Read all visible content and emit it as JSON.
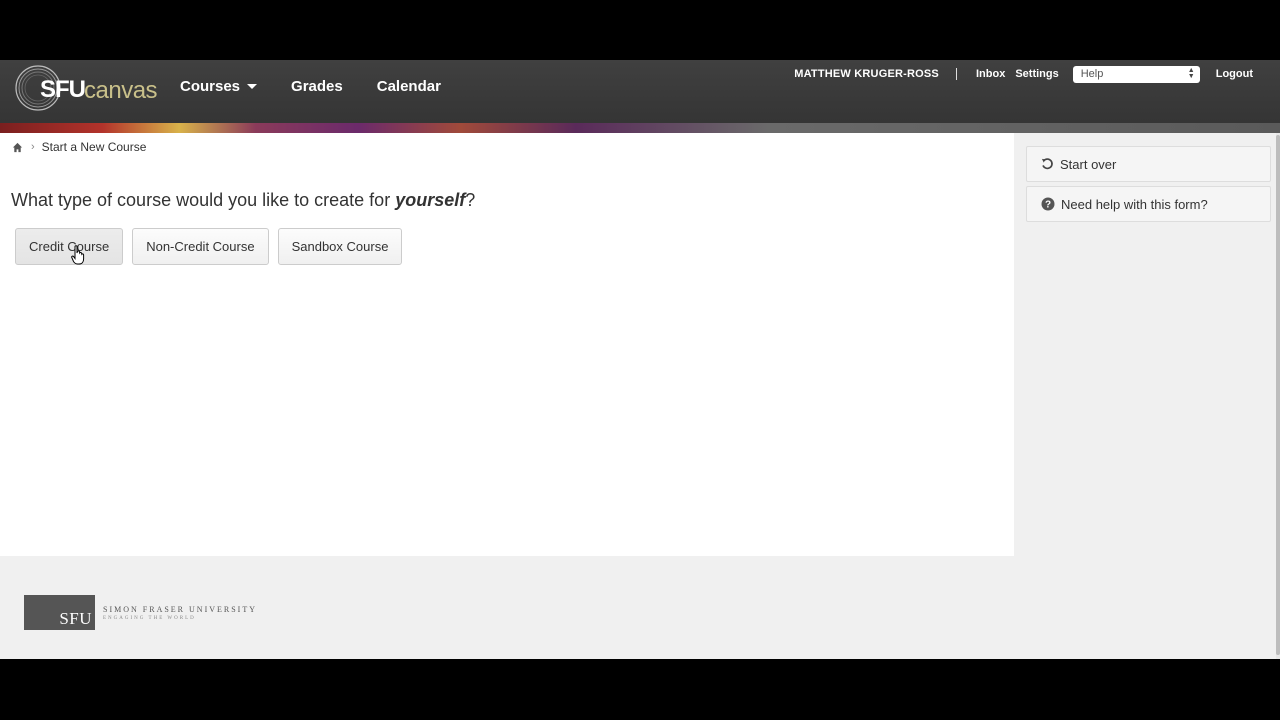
{
  "header": {
    "brand_sfu": "SFU",
    "brand_canvas": "canvas",
    "nav": [
      "Courses",
      "Grades",
      "Calendar"
    ],
    "username": "MATTHEW KRUGER-ROSS",
    "inbox": "Inbox",
    "settings": "Settings",
    "help_select": "Help",
    "logout": "Logout"
  },
  "breadcrumb": {
    "current": "Start a New Course"
  },
  "main": {
    "question_prefix": "What type of course would you like to create for ",
    "question_emph": "yourself",
    "question_suffix": "?",
    "buttons": [
      "Credit Course",
      "Non-Credit Course",
      "Sandbox Course"
    ]
  },
  "sidebar": {
    "start_over": "Start over",
    "need_help": "Need help with this form?"
  },
  "footer": {
    "sfu_mark": "SFU",
    "university_name": "SIMON FRASER UNIVERSITY",
    "tagline": "ENGAGING THE WORLD"
  },
  "colors": {
    "header_bg": "#383838",
    "canvas_gold": "#c9c08a",
    "sidebar_bg": "#f0f0f0"
  }
}
